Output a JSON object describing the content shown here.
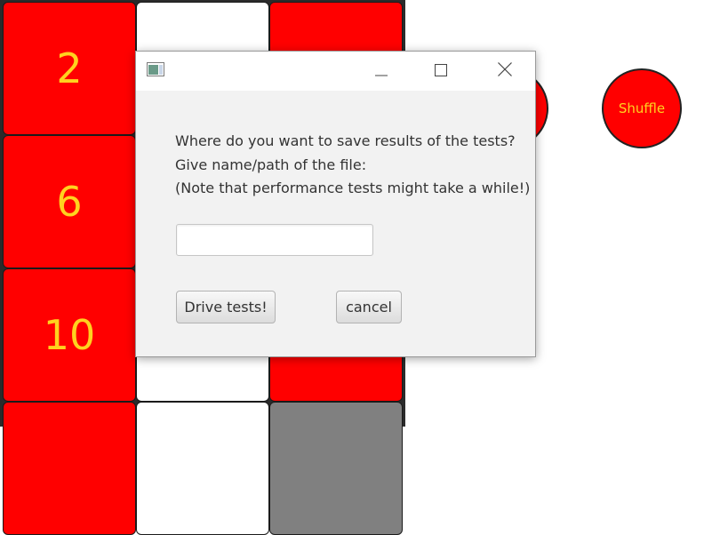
{
  "board": {
    "tiles": [
      {
        "label": "2",
        "color": "#ff0000"
      },
      {
        "label": "",
        "color": "#ffffff"
      },
      {
        "label": "",
        "color": "#ff0000"
      },
      {
        "label": "6",
        "color": "#ff0000"
      },
      {
        "label": "10",
        "color": "#ff0000"
      },
      {
        "label": "",
        "color": "#ffffff"
      },
      {
        "label": "",
        "color": "#ff0000"
      },
      {
        "label": "",
        "color": "#808080"
      }
    ],
    "tile_text_color": "#ffd21f"
  },
  "controls": {
    "shuffle_label": "Shuffle"
  },
  "dialog": {
    "message_lines": [
      "Where do you want to save results of the tests?",
      "Give name/path of the file:",
      "(Note that performance tests might take a while!)"
    ],
    "file_field_value": "",
    "drive_button_label": "Drive tests!",
    "cancel_button_label": "cancel",
    "titlebar_icons": [
      "app-icon",
      "minimize-icon",
      "maximize-icon",
      "close-icon"
    ]
  }
}
